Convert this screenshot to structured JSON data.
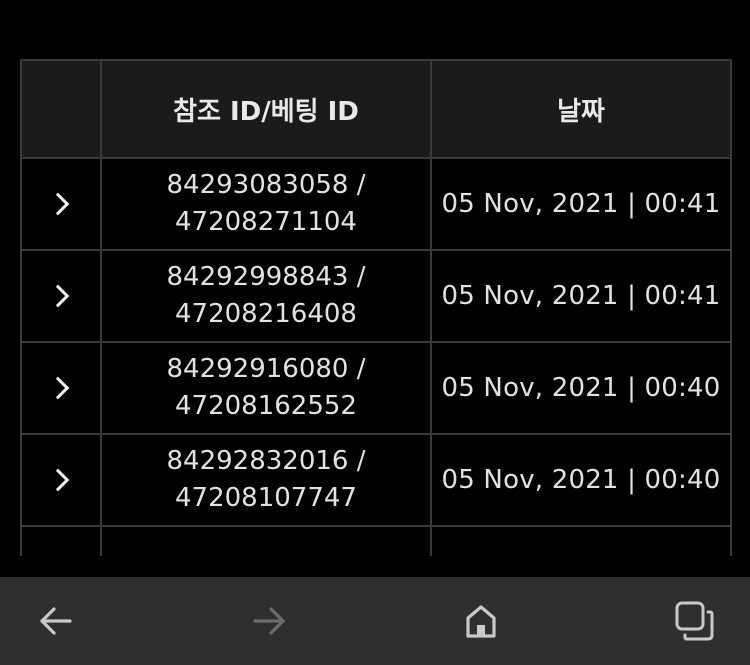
{
  "table": {
    "headers": {
      "expand": "",
      "reference": "참조 ID/베팅 ID",
      "date": "날짜"
    },
    "rows": [
      {
        "ref_line1": "84293083058 /",
        "ref_line2": "47208271104",
        "date": "05 Nov, 2021 | 00:41"
      },
      {
        "ref_line1": "84292998843 /",
        "ref_line2": "47208216408",
        "date": "05 Nov, 2021 | 00:41"
      },
      {
        "ref_line1": "84292916080 /",
        "ref_line2": "47208162552",
        "date": "05 Nov, 2021 | 00:40"
      },
      {
        "ref_line1": "84292832016 /",
        "ref_line2": "47208107747",
        "date": "05 Nov, 2021 | 00:40"
      }
    ]
  },
  "navbar": {
    "back_icon": "arrow-left-icon",
    "forward_icon": "arrow-right-icon",
    "home_icon": "home-icon",
    "tabs_icon": "tabs-icon",
    "forward_enabled": false,
    "icon_color": "#c9c9c9",
    "disabled_icon_color": "#6c6c6c"
  }
}
